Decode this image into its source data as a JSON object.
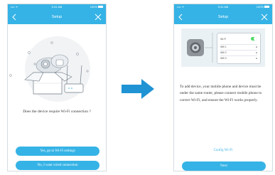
{
  "status_bar": {
    "carrier": "•••• ᯤ",
    "time": "9:41 AM",
    "battery": "100%"
  },
  "header": {
    "title": "Setup"
  },
  "colors": {
    "accent": "#36b3e6",
    "diagram_bg": "#eaf1f5",
    "arrow": "#1f93d3"
  },
  "left_screen": {
    "question": "Does the device require Wi-Fi connection ?",
    "buttons": {
      "yes": "Yes, go to Wi-Fi settings",
      "no": "No, I want wired connection"
    }
  },
  "right_screen": {
    "description_lines": [
      "To add device, your mobile phone and device must be",
      "under the same router, please connect mobile phone to",
      "correct Wi-Fi, and ensure the Wi-Fi works properly."
    ],
    "wifi_settings": {
      "title": "Wi-Fi",
      "networks": [
        "Wifi 1",
        "Wifi 2",
        "Wifi 3"
      ]
    },
    "config_link": "Config Wi-Fi",
    "next_button": "Next"
  }
}
